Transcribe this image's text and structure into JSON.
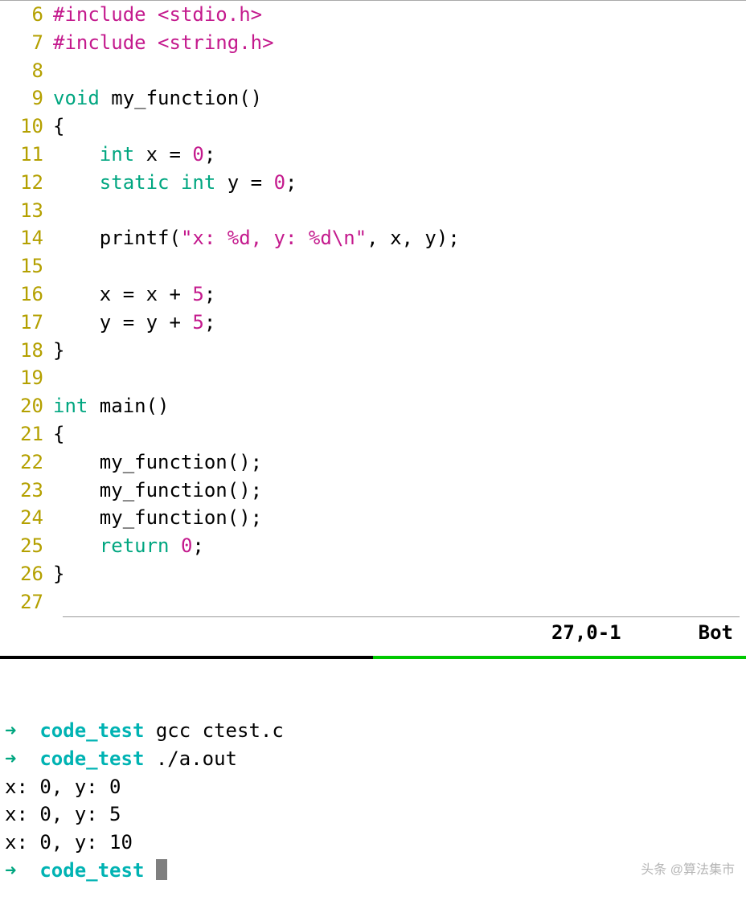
{
  "editor": {
    "lines": [
      {
        "num": "6",
        "tokens": [
          [
            "preproc",
            "#include"
          ],
          [
            "plain",
            " "
          ],
          [
            "header",
            "<stdio.h>"
          ]
        ]
      },
      {
        "num": "7",
        "tokens": [
          [
            "preproc",
            "#include"
          ],
          [
            "plain",
            " "
          ],
          [
            "header",
            "<string.h>"
          ]
        ]
      },
      {
        "num": "8",
        "tokens": []
      },
      {
        "num": "9",
        "tokens": [
          [
            "type",
            "void"
          ],
          [
            "plain",
            " my_function()"
          ]
        ]
      },
      {
        "num": "10",
        "tokens": [
          [
            "plain",
            "{"
          ]
        ]
      },
      {
        "num": "11",
        "tokens": [
          [
            "plain",
            "    "
          ],
          [
            "type",
            "int"
          ],
          [
            "plain",
            " x = "
          ],
          [
            "num",
            "0"
          ],
          [
            "plain",
            ";"
          ]
        ]
      },
      {
        "num": "12",
        "tokens": [
          [
            "plain",
            "    "
          ],
          [
            "type",
            "static"
          ],
          [
            "plain",
            " "
          ],
          [
            "type",
            "int"
          ],
          [
            "plain",
            " y = "
          ],
          [
            "num",
            "0"
          ],
          [
            "plain",
            ";"
          ]
        ]
      },
      {
        "num": "13",
        "tokens": []
      },
      {
        "num": "14",
        "tokens": [
          [
            "plain",
            "    printf("
          ],
          [
            "str",
            "\"x: "
          ],
          [
            "fmt",
            "%d"
          ],
          [
            "str",
            ", y: "
          ],
          [
            "fmt",
            "%d"
          ],
          [
            "str",
            "\\n\""
          ],
          [
            "plain",
            ", x, y);"
          ]
        ]
      },
      {
        "num": "15",
        "tokens": []
      },
      {
        "num": "16",
        "tokens": [
          [
            "plain",
            "    x = x + "
          ],
          [
            "num",
            "5"
          ],
          [
            "plain",
            ";"
          ]
        ]
      },
      {
        "num": "17",
        "tokens": [
          [
            "plain",
            "    y = y + "
          ],
          [
            "num",
            "5"
          ],
          [
            "plain",
            ";"
          ]
        ]
      },
      {
        "num": "18",
        "tokens": [
          [
            "plain",
            "}"
          ]
        ]
      },
      {
        "num": "19",
        "tokens": []
      },
      {
        "num": "20",
        "tokens": [
          [
            "type",
            "int"
          ],
          [
            "plain",
            " main()"
          ]
        ]
      },
      {
        "num": "21",
        "tokens": [
          [
            "plain",
            "{"
          ]
        ]
      },
      {
        "num": "22",
        "tokens": [
          [
            "plain",
            "    my_function();"
          ]
        ]
      },
      {
        "num": "23",
        "tokens": [
          [
            "plain",
            "    my_function();"
          ]
        ]
      },
      {
        "num": "24",
        "tokens": [
          [
            "plain",
            "    my_function();"
          ]
        ]
      },
      {
        "num": "25",
        "tokens": [
          [
            "plain",
            "    "
          ],
          [
            "type",
            "return"
          ],
          [
            "plain",
            " "
          ],
          [
            "num",
            "0"
          ],
          [
            "plain",
            ";"
          ]
        ]
      },
      {
        "num": "26",
        "tokens": [
          [
            "plain",
            "}"
          ]
        ]
      },
      {
        "num": "27",
        "tokens": []
      }
    ],
    "status": {
      "pos": "27,0-1",
      "scroll": "Bot"
    }
  },
  "terminal": {
    "arrow": "➜",
    "cwd": "code_test",
    "lines": [
      {
        "kind": "prompt",
        "cmd": "gcc ctest.c"
      },
      {
        "kind": "prompt",
        "cmd": "./a.out"
      },
      {
        "kind": "output",
        "text": "x: 0, y: 0"
      },
      {
        "kind": "output",
        "text": "x: 0, y: 5"
      },
      {
        "kind": "output",
        "text": "x: 0, y: 10"
      },
      {
        "kind": "prompt",
        "cmd": "",
        "cursor": true
      }
    ]
  },
  "watermark": "头条 @算法集市"
}
